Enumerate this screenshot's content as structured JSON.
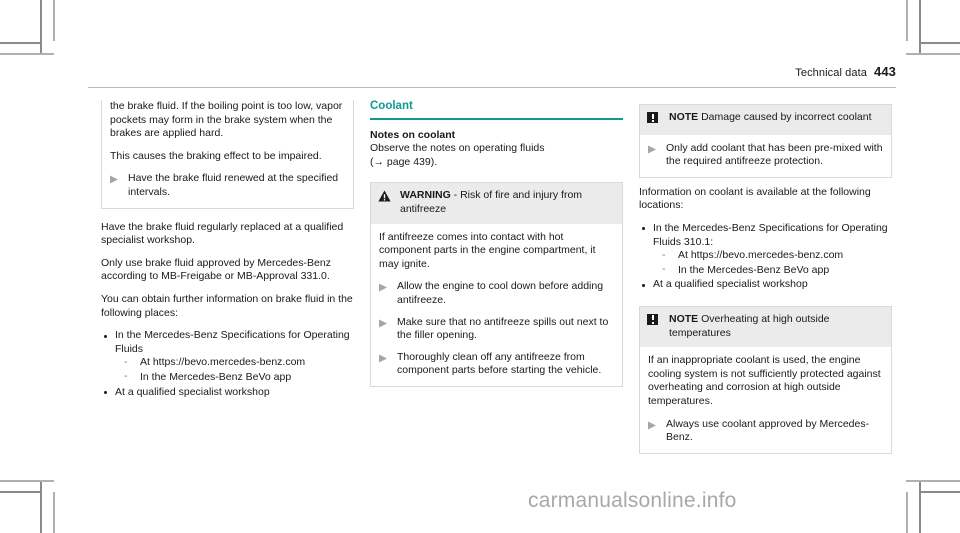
{
  "header": {
    "chapter": "Technical data",
    "page_number": "443",
    "rule_color": "#aebfbd"
  },
  "watermark": "carmanualsonline.info",
  "accent_color": "#0d9a94",
  "columns": {
    "left": {
      "continued_warning": {
        "body_paragraphs": [
          "the brake fluid. If the boiling point is too low, vapor pockets may form in the brake system when the brakes are applied hard.",
          "This causes the braking effect to be impaired."
        ],
        "steps": [
          "Have the brake fluid renewed at the specified intervals."
        ]
      },
      "paragraphs": [
        "Have the brake fluid regularly replaced at a qualified specialist workshop.",
        "Only use brake fluid approved by Mercedes-Benz according to MB-Freigabe or MB-Approval 331.0.",
        "You can obtain further information on brake fluid in the following places:"
      ],
      "bullets": [
        {
          "text": "In the Mercedes-Benz Specifications for Operating Fluids",
          "sub": [
            "At https://bevo.mercedes-benz.com",
            "In the Mercedes-Benz BeVo app"
          ]
        },
        {
          "text": "At a qualified specialist workshop",
          "sub": []
        }
      ]
    },
    "middle": {
      "section_title": "Coolant",
      "subhead": "Notes on coolant",
      "intro_line1": "Observe the notes on operating fluids",
      "intro_line2": "(→ page 439).",
      "warning": {
        "icon": "warning-triangle-icon",
        "label": "WARNING",
        "title_rest": " - Risk of fire and injury from antifreeze",
        "body": "If antifreeze comes into contact with hot component parts in the engine compartment, it may ignite.",
        "steps": [
          "Allow the engine to cool down before adding antifreeze.",
          "Make sure that no antifreeze spills out next to the filler opening.",
          "Thoroughly clean off any antifreeze from component parts before starting the vehicle."
        ]
      }
    },
    "right": {
      "note_one": {
        "icon": "note-square-icon",
        "label": "NOTE",
        "title_rest": " Damage caused by incorrect coolant",
        "steps": [
          "Only add coolant that has been pre-mixed with the required antifreeze protection."
        ],
        "body_after": "Information on coolant is available at the following locations:",
        "bullets": [
          {
            "text": "In the Mercedes-Benz Specifications for Operating Fluids 310.1:",
            "sub": [
              "At https://bevo.mercedes-benz.com",
              "In the Mercedes-Benz BeVo app"
            ]
          },
          {
            "text": "At a qualified specialist workshop",
            "sub": []
          }
        ]
      },
      "note_two": {
        "icon": "note-square-icon",
        "label": "NOTE",
        "title_rest": " Overheating at high outside temperatures",
        "body": "If an inappropriate coolant is used, the engine cooling system is not sufficiently protected against overheating and corrosion at high outside temperatures.",
        "steps": [
          "Always use coolant approved by Mercedes-Benz."
        ]
      }
    }
  }
}
